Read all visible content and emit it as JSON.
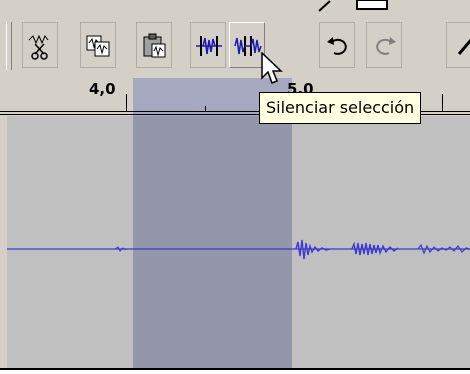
{
  "ruler": {
    "labels": [
      "4,0",
      "5,0"
    ]
  },
  "tooltip": {
    "text": "Silenciar selección"
  },
  "toolbar": {
    "buttons": [
      {
        "name": "cut-button",
        "icon": "scissors-icon"
      },
      {
        "name": "copy-button",
        "icon": "copy-icon"
      },
      {
        "name": "paste-button",
        "icon": "paste-icon"
      },
      {
        "name": "trim-button",
        "icon": "trim-icon"
      },
      {
        "name": "silence-button",
        "icon": "silence-icon"
      },
      {
        "name": "undo-button",
        "icon": "undo-icon"
      },
      {
        "name": "redo-button",
        "icon": "redo-icon"
      }
    ]
  },
  "colors": {
    "selection": "#9496aa",
    "waveform": "#3b3bd0",
    "tooltip_bg": "#ffffe1"
  }
}
